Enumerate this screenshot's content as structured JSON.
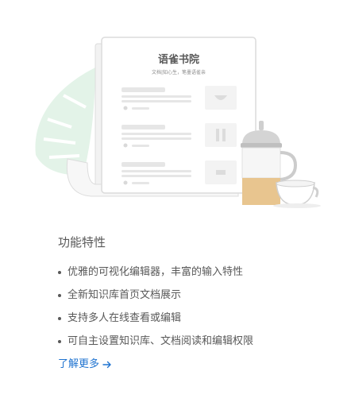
{
  "illustration": {
    "doc_title": "语雀书院",
    "doc_subtitle": "文档|知心生，笔墨语雀亲"
  },
  "features": {
    "title": "功能特性",
    "items": [
      "优雅的可视化编辑器，丰富的输入特性",
      "全新知识库首页文档展示",
      "支持多人在线查看或编辑",
      "可自主设置知识库、文档阅读和编辑权限"
    ],
    "learn_more": "了解更多"
  },
  "colors": {
    "link": "#1f73d0",
    "leaf": "#e3f3e8",
    "tea": "#e8c58f"
  }
}
